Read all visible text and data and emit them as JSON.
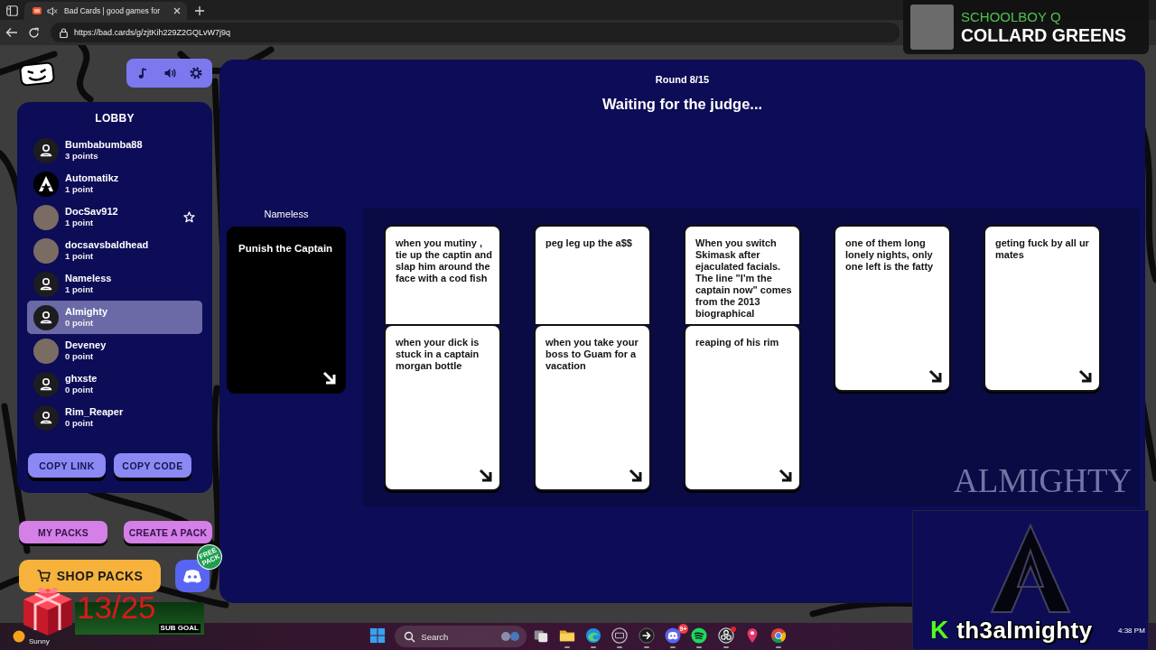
{
  "browser": {
    "tab": {
      "title": "Bad Cards | good games for",
      "muted": true
    },
    "address": "https://bad.cards/g/zjtKih229Z2GQLvW7j9q"
  },
  "lobby": {
    "title": "LOBBY",
    "players": [
      {
        "name": "Bumbabumba88",
        "points": "3 points",
        "kind": "default",
        "starred": false,
        "selected": false
      },
      {
        "name": "Automatikz",
        "points": "1 point",
        "kind": "logo",
        "starred": false,
        "selected": false
      },
      {
        "name": "DocSav912",
        "points": "1 point",
        "kind": "photo",
        "starred": true,
        "selected": false
      },
      {
        "name": "docsavsbaldhead",
        "points": "1 point",
        "kind": "photo",
        "starred": false,
        "selected": false
      },
      {
        "name": "Nameless",
        "points": "1 point",
        "kind": "default",
        "starred": false,
        "selected": false
      },
      {
        "name": "Almighty",
        "points": "0 point",
        "kind": "default",
        "starred": false,
        "selected": true
      },
      {
        "name": "Deveney",
        "points": "0 point",
        "kind": "photo",
        "starred": false,
        "selected": false
      },
      {
        "name": "ghxste",
        "points": "0 point",
        "kind": "default",
        "starred": false,
        "selected": false
      },
      {
        "name": "Rim_Reaper",
        "points": "0 point",
        "kind": "default",
        "starred": false,
        "selected": false
      }
    ],
    "buttons": [
      "COPY LINK",
      "COPY CODE"
    ]
  },
  "packs": {
    "buttons": [
      "MY PACKS",
      "CREATE A PACK"
    ],
    "shop": "SHOP PACKS",
    "chat_badge": "FREE PACK"
  },
  "game": {
    "round": "Round 8/15",
    "status": "Waiting for the judge...",
    "prompt": {
      "player": "Nameless",
      "text": "Punish the Captain"
    },
    "answers": [
      {
        "cards": [
          "when you mutiny , tie up the captin and slap him around the face with a cod fish",
          "when your dick is stuck in a captain morgan bottle"
        ]
      },
      {
        "cards": [
          "peg leg up the a$$",
          "when you take your boss to Guam for a vacation"
        ]
      },
      {
        "cards": [
          "When you switch Skimask after ejaculated facials. The line \"I'm the captain now\" comes from the 2013 biographical",
          "reaping of his rim"
        ]
      },
      {
        "cards": [
          "one of them long lonely nights, only one left is the fatty"
        ]
      },
      {
        "cards": [
          "geting fuck by all ur mates"
        ]
      }
    ]
  },
  "stream_overlay": {
    "now_playing": {
      "artist": "SCHOOLBOY Q",
      "title": "COLLARD GREENS"
    },
    "logo_text": "ALMIGHTY",
    "channel": {
      "mark": "K",
      "name": "th3almighty"
    },
    "sub_goal": {
      "count": "13/25",
      "label": "SUB GOAL"
    }
  },
  "taskbar": {
    "weather": "Sunny",
    "apps": [
      {
        "kind": "start",
        "running": false
      },
      {
        "kind": "search",
        "placeholder": "Search",
        "running": false
      },
      {
        "kind": "task-view",
        "running": false
      },
      {
        "kind": "folder",
        "running": true
      },
      {
        "kind": "browser-swirl",
        "running": true
      },
      {
        "kind": "keyboard",
        "running": true
      },
      {
        "kind": "arrow",
        "running": true
      },
      {
        "kind": "chat",
        "badge": "9+",
        "running": true
      },
      {
        "kind": "music",
        "running": true
      },
      {
        "kind": "recorder",
        "alert": true,
        "running": true
      },
      {
        "kind": "pin",
        "running": false
      },
      {
        "kind": "browser-rings",
        "running": true
      }
    ],
    "time": "4:38 PM"
  }
}
